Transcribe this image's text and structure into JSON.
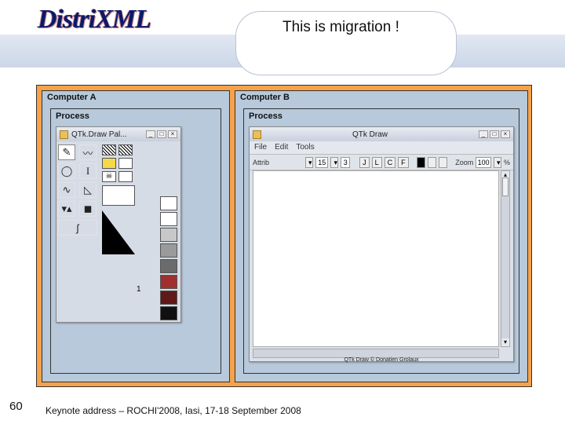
{
  "logo": "DistriXML",
  "slide_title": "This is migration !",
  "slide_number": "60",
  "footer": "Keynote address – ROCHI'2008, Iasi, 17-18 September 2008",
  "computer_a": {
    "label": "Computer A",
    "process_label": "Process",
    "window": {
      "title": "QTk.Draw Pal...",
      "indicator_value": "1"
    }
  },
  "computer_b": {
    "label": "Computer B",
    "process_label": "Process",
    "window": {
      "title": "QTk Draw",
      "menus": [
        "File",
        "Edit",
        "Tools"
      ],
      "toolbar": {
        "attrib_label": "Attrib",
        "field1": "15",
        "field2": "3",
        "buttons": [
          "J",
          "L",
          "C",
          "F"
        ],
        "zoom_label": "Zoom",
        "zoom_value": "100",
        "percent": "%"
      },
      "status": "QTk Draw © Donatien Grolaux"
    }
  }
}
